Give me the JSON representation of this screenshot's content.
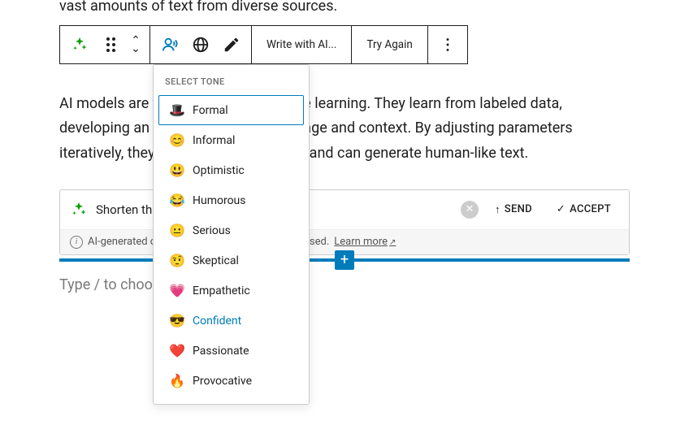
{
  "truncated_top": "vast amounts of text from diverse sources.",
  "toolbar": {
    "write_ai": "Write with AI...",
    "try_again": "Try Again"
  },
  "paragraph": "AI models are trained through machine learning. They learn from labeled data, developing an understanding of language and context. By adjusting parameters iteratively, they improve their accuracy and can generate human-like text.",
  "ai_panel": {
    "prompt_text": "Shorten the text",
    "send": "SEND",
    "accept": "ACCEPT",
    "footer_text": "AI-generated content could be inaccurate or biased.",
    "learn_more": "Learn more"
  },
  "placeholder": "Type / to choose a block",
  "dropdown": {
    "header": "SELECT TONE",
    "items": [
      {
        "emoji": "🎩",
        "label": "Formal",
        "selected": true
      },
      {
        "emoji": "😊",
        "label": "Informal"
      },
      {
        "emoji": "😃",
        "label": "Optimistic"
      },
      {
        "emoji": "😂",
        "label": "Humorous"
      },
      {
        "emoji": "😐",
        "label": "Serious"
      },
      {
        "emoji": "🤨",
        "label": "Skeptical"
      },
      {
        "emoji": "💗",
        "label": "Empathetic"
      },
      {
        "emoji": "😎",
        "label": "Confident",
        "hovered": true
      },
      {
        "emoji": "❤️",
        "label": "Passionate"
      },
      {
        "emoji": "🔥",
        "label": "Provocative"
      }
    ]
  }
}
